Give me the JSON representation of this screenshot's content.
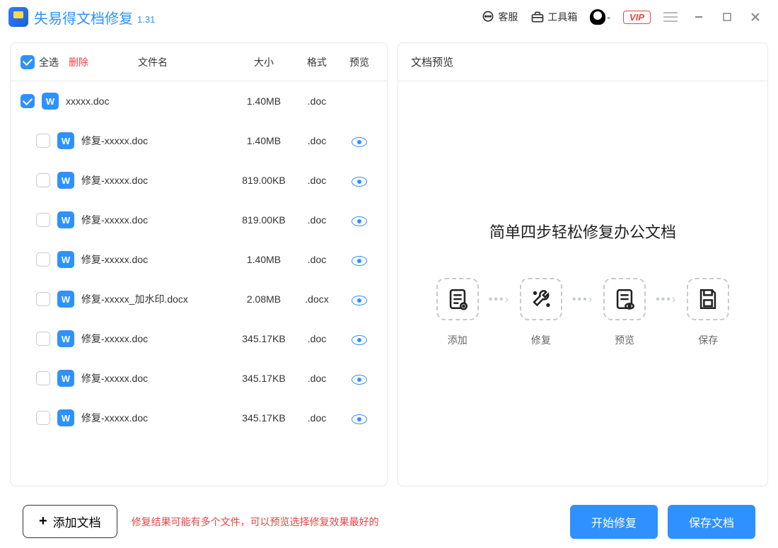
{
  "app": {
    "title": "失易得文档修复",
    "version": "1.31"
  },
  "titlebar": {
    "service": "客服",
    "toolbox": "工具箱",
    "qq_suffix": "-",
    "vip": "VIP"
  },
  "list_header": {
    "select_all": "全选",
    "delete": "删除",
    "filename": "文件名",
    "size": "大小",
    "format": "格式",
    "preview": "预览"
  },
  "files": [
    {
      "checked": true,
      "child": false,
      "name": "xxxxx.doc",
      "size": "1.40MB",
      "format": ".doc",
      "preview": false
    },
    {
      "checked": false,
      "child": true,
      "name": "修复-xxxxx.doc",
      "size": "1.40MB",
      "format": ".doc",
      "preview": true
    },
    {
      "checked": false,
      "child": true,
      "name": "修复-xxxxx.doc",
      "size": "819.00KB",
      "format": ".doc",
      "preview": true
    },
    {
      "checked": false,
      "child": true,
      "name": "修复-xxxxx.doc",
      "size": "819.00KB",
      "format": ".doc",
      "preview": true
    },
    {
      "checked": false,
      "child": true,
      "name": "修复-xxxxx.doc",
      "size": "1.40MB",
      "format": ".doc",
      "preview": true
    },
    {
      "checked": false,
      "child": true,
      "name": "修复-xxxxx_加水印.docx",
      "size": "2.08MB",
      "format": ".docx",
      "preview": true
    },
    {
      "checked": false,
      "child": true,
      "name": "修复-xxxxx.doc",
      "size": "345.17KB",
      "format": ".doc",
      "preview": true
    },
    {
      "checked": false,
      "child": true,
      "name": "修复-xxxxx.doc",
      "size": "345.17KB",
      "format": ".doc",
      "preview": true
    },
    {
      "checked": false,
      "child": true,
      "name": "修复-xxxxx.doc",
      "size": "345.17KB",
      "format": ".doc",
      "preview": true
    }
  ],
  "preview": {
    "header": "文档预览",
    "title": "简单四步轻松修复办公文档",
    "steps": [
      "添加",
      "修复",
      "预览",
      "保存"
    ]
  },
  "footer": {
    "add_doc": "添加文档",
    "hint": "修复结果可能有多个文件，可以预览选择修复效果最好的",
    "start_repair": "开始修复",
    "save_doc": "保存文档"
  }
}
